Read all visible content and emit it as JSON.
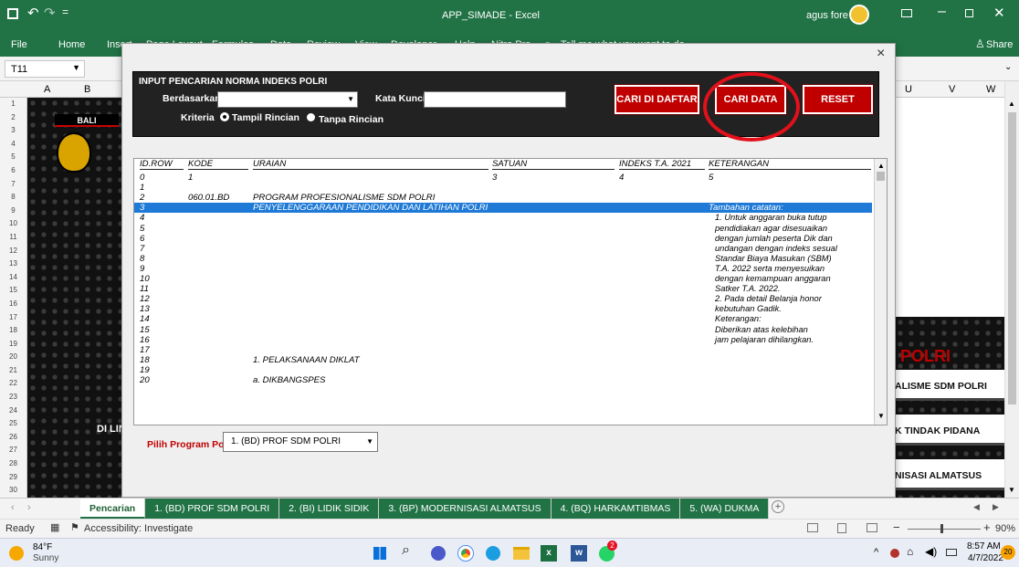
{
  "window": {
    "title": "APP_SIMADE  -  Excel",
    "user": "agus fore",
    "share_label": "Share"
  },
  "ribbon_tabs": [
    "File",
    "Home",
    "Insert",
    "Page Layout",
    "Formulas",
    "Data",
    "Review",
    "View",
    "Developer",
    "Help",
    "Nitro Pro"
  ],
  "tell_me": "Tell me what you want to do",
  "name_box": "T11",
  "columns": {
    "a": "A",
    "b": "B",
    "u": "U",
    "v": "V",
    "w": "W"
  },
  "rows": [
    "1",
    "2",
    "3",
    "4",
    "5",
    "6",
    "7",
    "8",
    "9",
    "10",
    "11",
    "12",
    "13",
    "14",
    "15",
    "16",
    "17",
    "18",
    "19",
    "20",
    "21",
    "22",
    "23",
    "24",
    "25",
    "26",
    "27",
    "28",
    "29",
    "30"
  ],
  "sheet": {
    "bali_text": "BALI",
    "di_lin": "DI LIN",
    "polri": "POLRI",
    "alisme": "ALISME SDM POLRI",
    "tindak": "K TINDAK PIDANA",
    "nisasi": "NISASI ALMATSUS"
  },
  "dialog": {
    "close": "×",
    "group_title": "INPUT PENCARIAN NORMA INDEKS POLRI",
    "berdasarkan_label": "Berdasarkan",
    "berdasarkan_value": "",
    "kata_kunci_label": "Kata Kunci",
    "kata_kunci_value": "",
    "kriteria_label": "Kriteria",
    "opt1": "Tampil Rincian",
    "opt2": "Tanpa Rincian",
    "btn_cari_daftar": "CARI DI DAFTAR",
    "btn_cari_data": "CARI DATA",
    "btn_reset": "RESET",
    "headers": [
      "ID.ROW",
      "KODE",
      "URAIAN",
      "SATUAN",
      "INDEKS T.A. 2021",
      "KETERANGAN"
    ],
    "rows": [
      [
        "0",
        "1",
        "",
        "3",
        "4",
        "5"
      ],
      [
        "1",
        "",
        "",
        "",
        "",
        ""
      ],
      [
        "2",
        "060.01.BD",
        "PROGRAM PROFESIONALISME SDM POLRI",
        "",
        "",
        ""
      ],
      [
        "3",
        "",
        "PENYELENGGARAAN PENDIDIKAN DAN LATIHAN POLRI",
        "",
        "",
        "Tambahan catatan:"
      ],
      [
        "4",
        "",
        "",
        "",
        "",
        ""
      ],
      [
        "5",
        "",
        "",
        "",
        "",
        ""
      ],
      [
        "6",
        "",
        "",
        "",
        "",
        ""
      ],
      [
        "7",
        "",
        "",
        "",
        "",
        ""
      ],
      [
        "8",
        "",
        "",
        "",
        "",
        ""
      ],
      [
        "9",
        "",
        "",
        "",
        "",
        ""
      ],
      [
        "10",
        "",
        "",
        "",
        "",
        ""
      ],
      [
        "11",
        "",
        "",
        "",
        "",
        ""
      ],
      [
        "12",
        "",
        "",
        "",
        "",
        ""
      ],
      [
        "13",
        "",
        "",
        "",
        "",
        ""
      ],
      [
        "14",
        "",
        "",
        "",
        "",
        ""
      ],
      [
        "15",
        "",
        "",
        "",
        "",
        ""
      ],
      [
        "16",
        "",
        "",
        "",
        "",
        ""
      ],
      [
        "17",
        "",
        "",
        "",
        "",
        ""
      ],
      [
        "18",
        "",
        "1. PELAKSANAAN DIKLAT",
        "",
        "",
        ""
      ],
      [
        "19",
        "",
        "",
        "",
        "",
        ""
      ],
      [
        "20",
        "",
        "a. DIKBANGSPES",
        "",
        "",
        ""
      ]
    ],
    "notes": [
      "1. Untuk  anggaran  buka  tutup",
      "    pendidiakan  agar  disesuaikan",
      "    dengan jumlah peserta Dik dan",
      "    undangan dengan indeks sesual",
      "    Standar Biaya Masukan (SBM)",
      "    T.A. 2022  serta  menyesuikan",
      "    dengan kemampuan anggaran",
      "     Satker T.A. 2022.",
      "2. Pada   detail   Belanja   honor",
      "    kebutuhan Gadik.",
      "    Keterangan:",
      "     Diberikan  atas  kelebihan",
      "    jam pelajaran dihilangkan."
    ],
    "pilih_label": "Pilih Program Polri",
    "pilih_value": "1. (BD) PROF SDM POLRI"
  },
  "sheet_tabs": [
    "Pencarian",
    "1. (BD) PROF SDM POLRI",
    "2. (BI) LIDIK SIDIK",
    "3. (BP) MODERNISASI ALMATSUS",
    "4. (BQ) HARKAMTIBMAS",
    "5. (WA) DUKMA"
  ],
  "status": {
    "ready": "Ready",
    "accessibility": "Accessibility: Investigate",
    "zoom": "90%"
  },
  "taskbar": {
    "temp": "84°F",
    "weather": "Sunny",
    "time": "8:57 AM",
    "date": "4/7/2022",
    "notif": "20",
    "chrome_badge": "2"
  },
  "colors": {
    "excel_green": "#217346",
    "dialog_dark": "#222222",
    "button_red": "#c00000",
    "selected_row": "#1e7ad6",
    "ring_red": "#e2101a"
  }
}
